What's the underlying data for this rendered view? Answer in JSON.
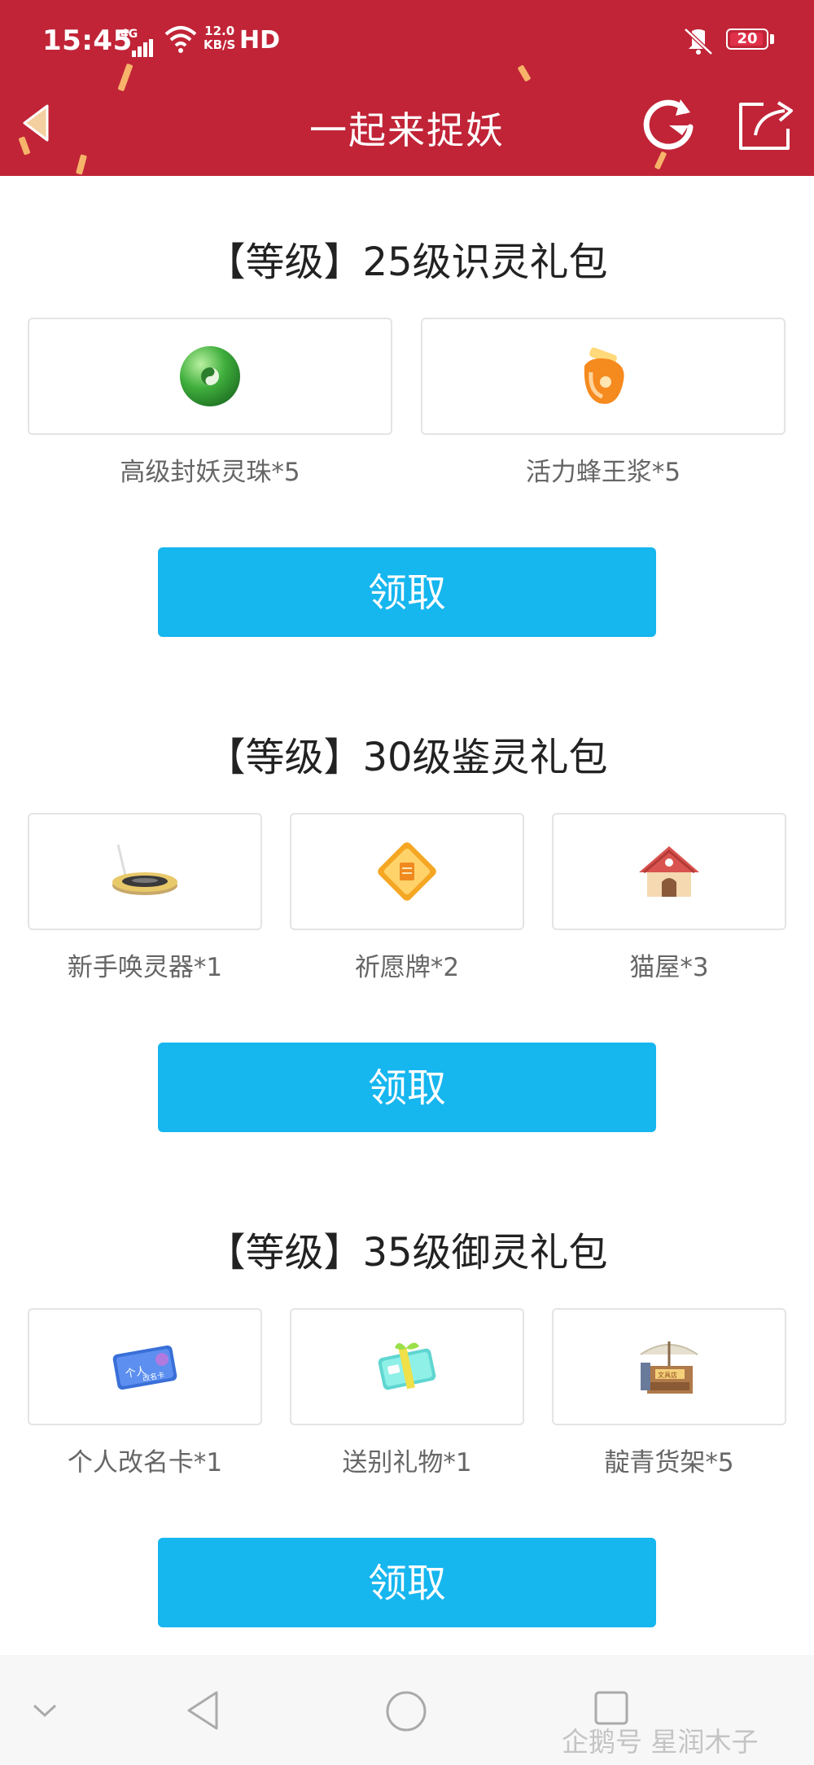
{
  "status_bar": {
    "time": "15:45",
    "network": "4G",
    "speed_value": "12.0",
    "speed_unit": "KB/S",
    "hd": "HD",
    "battery": "20"
  },
  "header": {
    "title": "一起来捉妖",
    "background_color": "#c12437"
  },
  "sections": [
    {
      "title": "【等级】25级识灵礼包",
      "items": [
        {
          "label": "高级封妖灵珠*5",
          "icon": "green-orb-icon"
        },
        {
          "label": "活力蜂王浆*5",
          "icon": "honey-jar-icon"
        }
      ],
      "button": "领取"
    },
    {
      "title": "【等级】30级鉴灵礼包",
      "items": [
        {
          "label": "新手唤灵器*1",
          "icon": "summoner-device-icon"
        },
        {
          "label": "祈愿牌*2",
          "icon": "wish-plaque-icon"
        },
        {
          "label": "猫屋*3",
          "icon": "cat-house-icon"
        }
      ],
      "button": "领取"
    },
    {
      "title": "【等级】35级御灵礼包",
      "items": [
        {
          "label": "个人改名卡*1",
          "icon": "rename-card-icon"
        },
        {
          "label": "送别礼物*1",
          "icon": "gift-box-icon"
        },
        {
          "label": "靛青货架*5",
          "icon": "market-stall-icon"
        }
      ],
      "button": "领取"
    }
  ],
  "rename_card_text": "个人",
  "rename_card_subtext": "改名卡",
  "stall_sign": "文具店",
  "accent_color": "#16b6ef",
  "watermark": "企鹅号 星润木子"
}
